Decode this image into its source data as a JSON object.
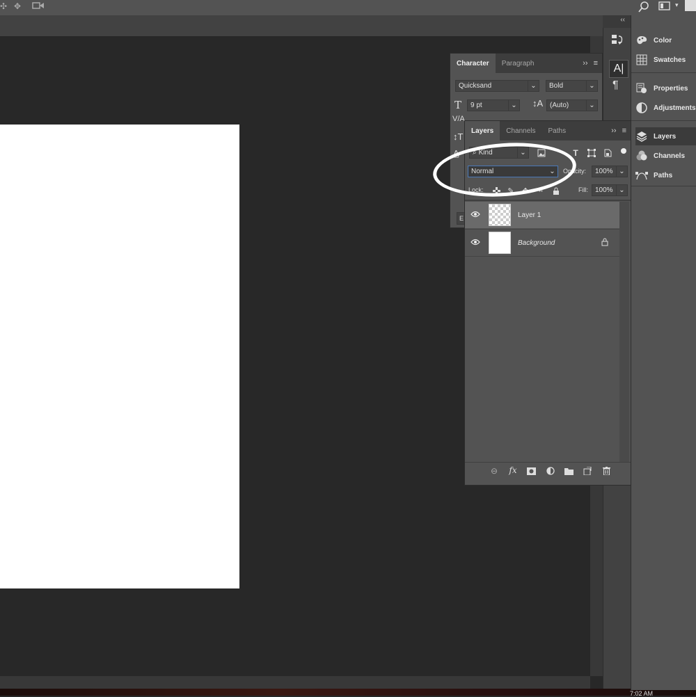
{
  "taskbar": {
    "time": "7:02 AM"
  },
  "right_panel": {
    "collapse_glyph": "‹‹",
    "items": [
      {
        "label": "Color",
        "icon": "color-icon"
      },
      {
        "label": "Swatches",
        "icon": "swatches-icon"
      },
      {
        "label": "Properties",
        "icon": "properties-icon"
      },
      {
        "label": "Adjustments",
        "icon": "adjustments-icon"
      },
      {
        "label": "Layers",
        "icon": "layers-icon",
        "active": true
      },
      {
        "label": "Channels",
        "icon": "channels-icon"
      },
      {
        "label": "Paths",
        "icon": "paths-icon"
      }
    ]
  },
  "character_panel": {
    "tabs": [
      "Character",
      "Paragraph"
    ],
    "font_family": "Quicksand",
    "font_style": "Bold",
    "font_size": "9 pt",
    "leading": "(Auto)",
    "truncated_button": "E"
  },
  "layers_panel": {
    "tabs": [
      "Layers",
      "Channels",
      "Paths"
    ],
    "filter_kind": "Kind",
    "blend_mode": "Normal",
    "opacity_label": "Opacity:",
    "opacity_value": "100%",
    "lock_label": "Lock:",
    "fill_label": "Fill:",
    "fill_value": "100%",
    "layers": [
      {
        "name": "Layer 1",
        "selected": true,
        "transparent": true
      },
      {
        "name": "Background",
        "selected": false,
        "locked": true,
        "italic": true
      }
    ],
    "footer_icons": [
      "link-icon",
      "fx-icon",
      "mask-icon",
      "adjustment-layer-icon",
      "group-folder-icon",
      "new-layer-icon",
      "trash-icon"
    ],
    "fx_text": "fx"
  },
  "annotation": {
    "color": "#ffffff"
  }
}
